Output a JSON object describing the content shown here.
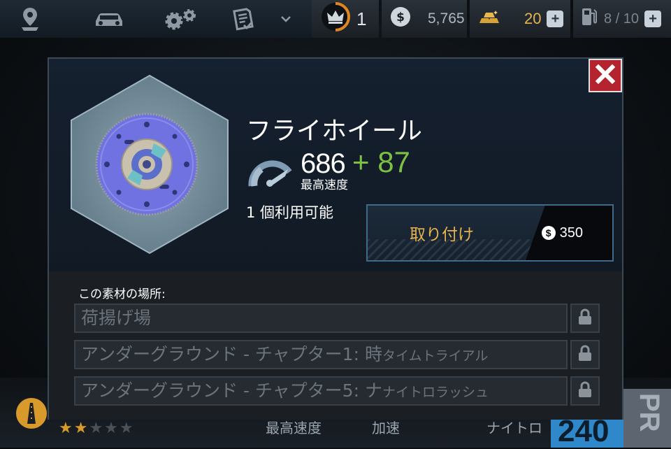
{
  "topbar": {
    "nav": [
      {
        "icon": "map-pin-icon"
      },
      {
        "icon": "car-icon"
      },
      {
        "icon": "gears-icon"
      },
      {
        "icon": "checklist-icon"
      },
      {
        "icon": "chevron-down-icon"
      }
    ],
    "crown": {
      "icon": "crown-icon",
      "value": "1"
    },
    "cash": {
      "icon": "dollar-coin-icon",
      "value": "5,765"
    },
    "gold": {
      "icon": "gold-bars-icon",
      "value": "20",
      "plus": "+"
    },
    "fuel": {
      "icon": "fuel-pump-icon",
      "value": "8 / 10",
      "plus": "+"
    }
  },
  "background": {
    "stat_speed": "最高速度",
    "stat_accel": "加速",
    "stat_nitro": "ナイトロ",
    "pr_label": "PR",
    "pr_value": "240"
  },
  "modal": {
    "close_icon": "close-x-icon",
    "part_name": "フライホイール",
    "stat_value": "686",
    "stat_bonus": "+ 87",
    "stat_label": "最高速度",
    "available": "1 個利用可能",
    "install_label": "取り付け",
    "install_cost": "350",
    "locations_title": "この素材の場所:",
    "locations": [
      {
        "main": "荷揚げ場",
        "small": ""
      },
      {
        "main": "アンダーグラウンド - チャプター1: 時",
        "small": "タイムトライアル"
      },
      {
        "main": "アンダーグラウンド - チャプター5: ナ",
        "small": "ナイトロラッシュ"
      }
    ]
  },
  "colors": {
    "accent_green": "#7bc142",
    "install_gold": "#e6b34e",
    "close_red": "#b3242f",
    "disc_purple": "#6f72e0"
  }
}
